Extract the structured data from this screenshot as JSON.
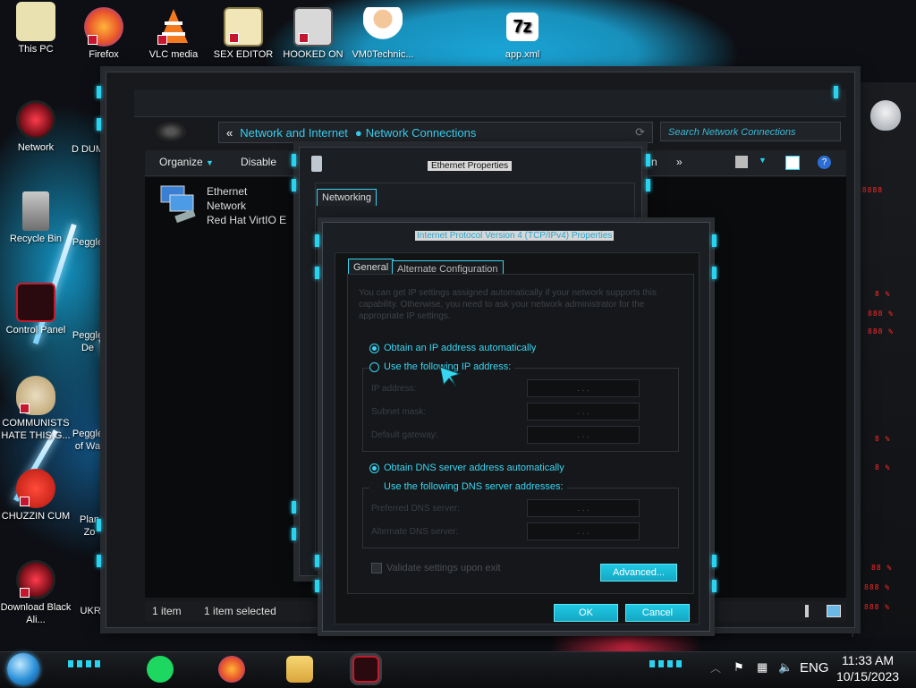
{
  "desktop": {
    "top_icons": [
      {
        "label": "This PC"
      },
      {
        "label": "Firefox"
      },
      {
        "label": "VLC media"
      },
      {
        "label": "SEX EDITOR"
      },
      {
        "label": "HOOKED ON"
      },
      {
        "label": "VM0Technic..."
      },
      {
        "label": "app.xml"
      }
    ],
    "left_icons": [
      {
        "label": "Network"
      },
      {
        "label": "Recycle Bin"
      },
      {
        "label": "Control Panel"
      },
      {
        "label": "COMMUNISTS HATE THIS G..."
      },
      {
        "label": "CHUZZIN CUM"
      },
      {
        "label": "Download Black Ali..."
      }
    ],
    "second_column_partial": [
      {
        "label": "D DUM"
      },
      {
        "label": "Peggle"
      },
      {
        "label": "Peggle De"
      },
      {
        "label": "Peggle of Wa"
      },
      {
        "label": "Plan Zo"
      },
      {
        "label": "UKRAINE"
      }
    ],
    "seven_zip_logo": "7z"
  },
  "explorer": {
    "breadcrumb": [
      "Network and Internet",
      "Network Connections"
    ],
    "back_chevrons": "«",
    "search_placeholder": "Search Network Connections",
    "toolbar": {
      "organize": "Organize",
      "disable": "Disable",
      "more": "»",
      "overflow_tail": "n"
    },
    "item": {
      "name": "Ethernet",
      "type": "Network",
      "adapter": "Red Hat VirtIO E"
    },
    "status": {
      "count": "1 item",
      "selected": "1 item selected"
    }
  },
  "ethernet_dialog": {
    "title": "Ethernet Properties",
    "tab": "Networking"
  },
  "ipv4_dialog": {
    "title": "Internet Protocol Version 4 (TCP/IPv4) Properties",
    "tabs": [
      {
        "label": "General"
      },
      {
        "label": "Alternate Configuration"
      }
    ],
    "description": "You can get IP settings assigned automatically if your network supports this capability. Otherwise, you need to ask your network administrator for the appropriate IP settings.",
    "ip_auto_label": "Obtain an IP address automatically",
    "ip_manual_label": "Use the following IP address:",
    "ip_fields": [
      {
        "label": "IP address:",
        "value": ". . ."
      },
      {
        "label": "Subnet mask:",
        "value": ". . ."
      },
      {
        "label": "Default gateway:",
        "value": ". . ."
      }
    ],
    "dns_auto_label": "Obtain DNS server address automatically",
    "dns_manual_label": "Use the following DNS server addresses:",
    "dns_fields": [
      {
        "label": "Preferred DNS server:",
        "value": ". . ."
      },
      {
        "label": "Alternate DNS server:",
        "value": ". . ."
      }
    ],
    "validate_label": "Validate settings upon exit",
    "advanced_button": "Advanced...",
    "ok_button": "OK",
    "cancel_button": "Cancel",
    "selected_ip_mode": "auto",
    "selected_dns_mode": "auto"
  },
  "gadget": {
    "readouts": [
      "88888",
      "8 %",
      "888 %",
      "888 %",
      "8 %",
      "8 %",
      "88 %",
      "888 %",
      "888 %"
    ]
  },
  "taskbar": {
    "language": "ENG",
    "time": "11:33 AM",
    "date": "10/15/2023"
  },
  "colors": {
    "accent": "#29d3f0",
    "window_bg": "#17191c",
    "readout_red": "#ff2b2b"
  }
}
